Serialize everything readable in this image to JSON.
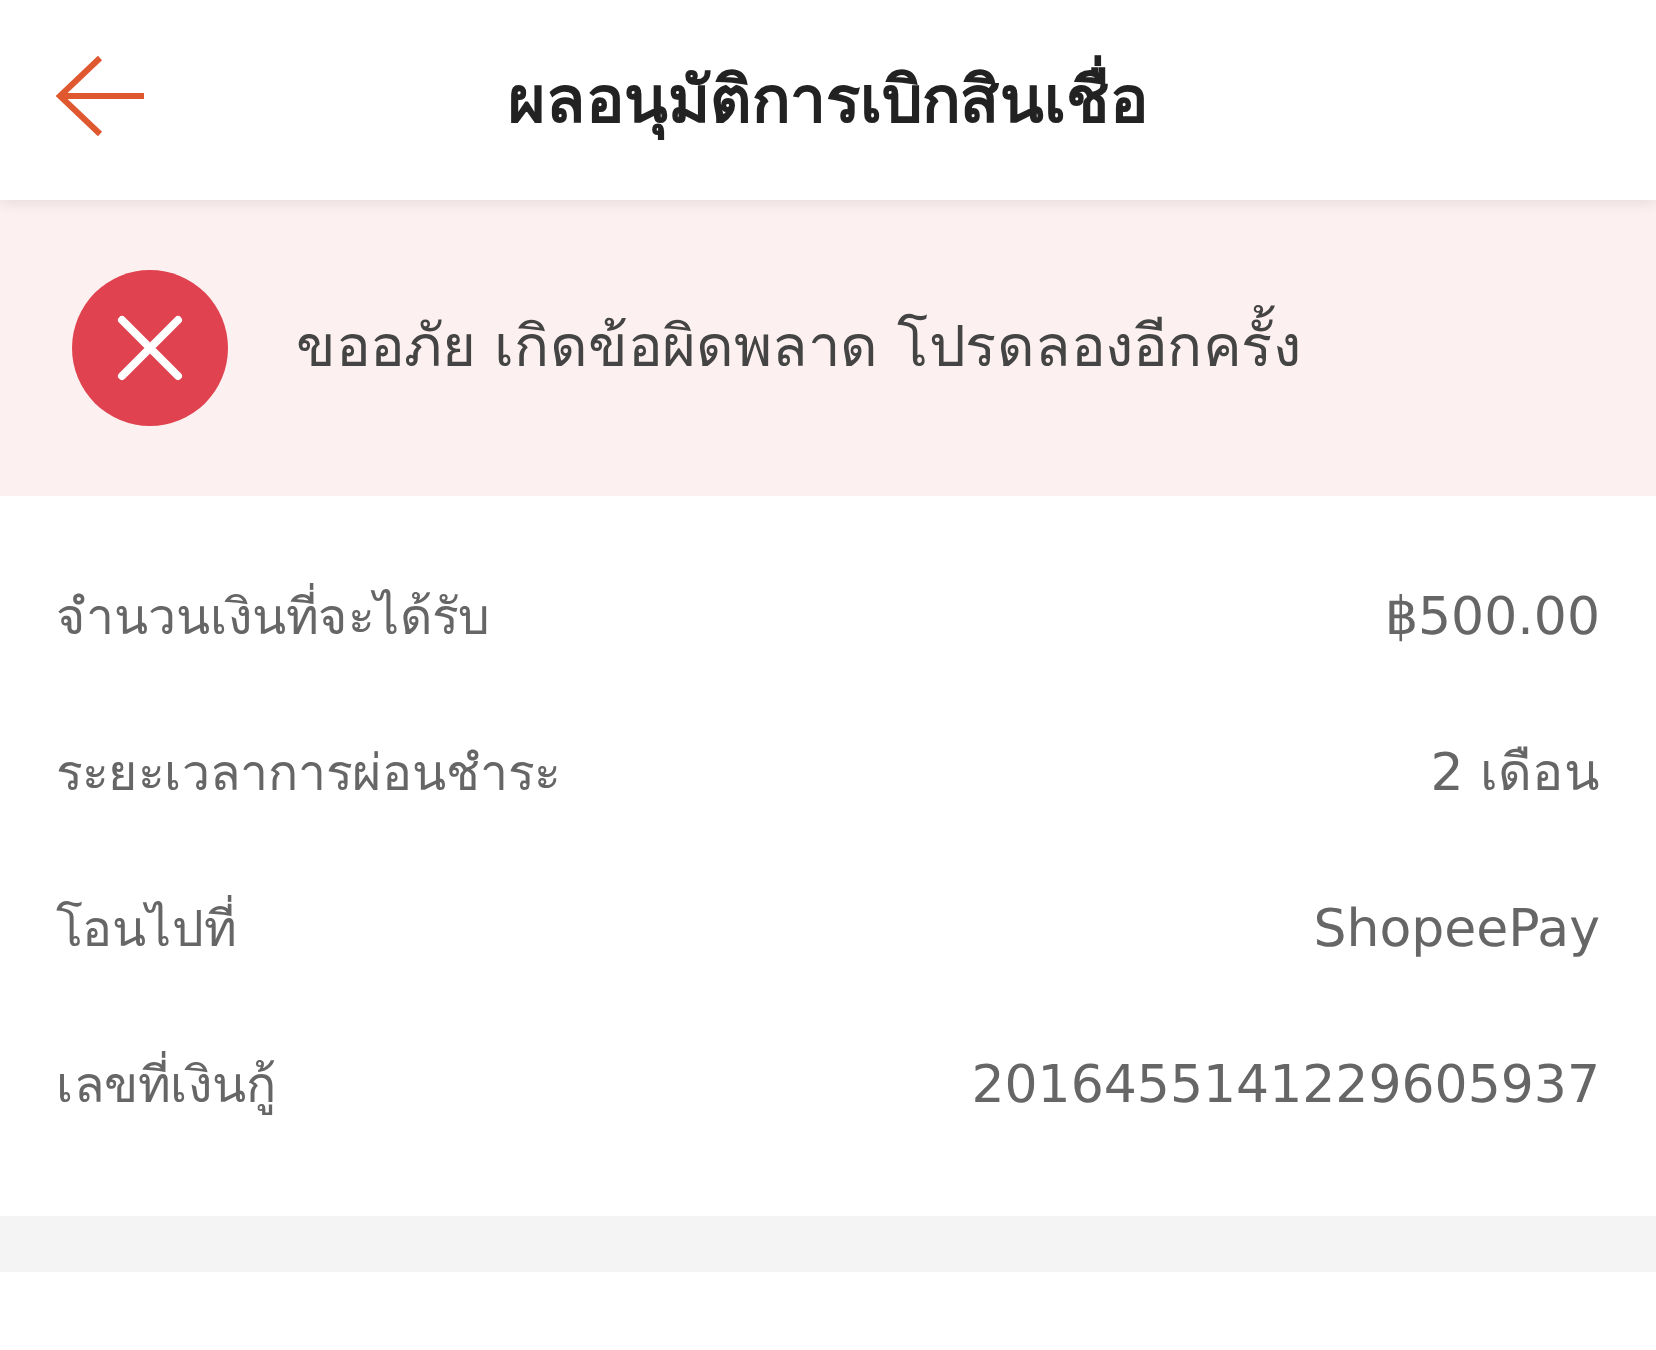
{
  "header": {
    "title": "ผลอนุมัติการเบิกสินเชื่อ"
  },
  "alert": {
    "kind": "error",
    "message": "ขออภัย เกิดข้อผิดพลาด โปรดลองอีกครั้ง"
  },
  "details": [
    {
      "label": "จำนวนเงินที่จะได้รับ",
      "value": "฿500.00"
    },
    {
      "label": "ระยะเวลาการผ่อนชำระ",
      "value": "2 เดือน"
    },
    {
      "label": "โอนไปที่",
      "value": "ShopeePay"
    },
    {
      "label": "เลขที่เงินกู้",
      "value": "2016455141229605937"
    }
  ]
}
